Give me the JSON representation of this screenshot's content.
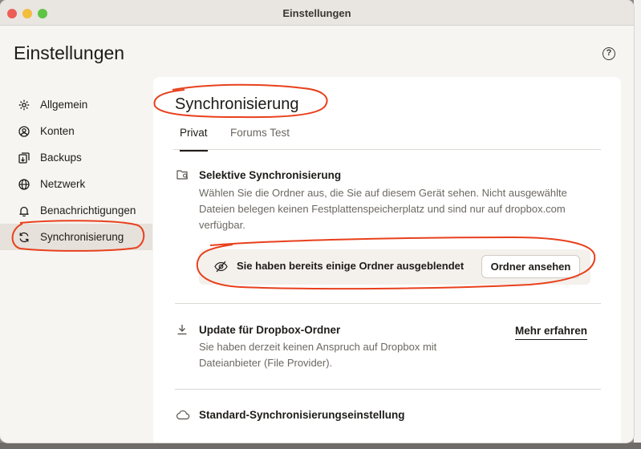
{
  "window": {
    "title": "Einstellungen"
  },
  "header": {
    "title": "Einstellungen",
    "help_icon": "question-circle-icon",
    "help_symbol": "?"
  },
  "sidebar": {
    "items": [
      {
        "label": "Allgemein",
        "icon": "gear-icon"
      },
      {
        "label": "Konten",
        "icon": "person-circle-icon"
      },
      {
        "label": "Backups",
        "icon": "backup-icon"
      },
      {
        "label": "Netzwerk",
        "icon": "globe-icon"
      },
      {
        "label": "Benachrichtigungen",
        "icon": "bell-icon"
      },
      {
        "label": "Synchronisierung",
        "icon": "sync-icon",
        "active": true
      }
    ]
  },
  "main": {
    "title": "Synchronisierung",
    "tabs": [
      {
        "label": "Privat",
        "active": true
      },
      {
        "label": "Forums Test",
        "active": false
      }
    ],
    "selective_sync": {
      "title": "Selektive Synchronisierung",
      "description_lines": [
        "Wählen Sie die Ordner aus, die Sie auf diesem Gerät sehen. Nicht ausgewählte",
        "Dateien belegen keinen Festplattenspeicherplatz und sind nur auf dropbox.com",
        "verfügbar."
      ],
      "banner_text": "Sie haben bereits einige Ordner ausgeblendet",
      "button_label": "Ordner ansehen",
      "icon": "folder-search-icon",
      "banner_icon": "eye-off-icon"
    },
    "update_folder": {
      "title": "Update für Dropbox-Ordner",
      "description_lines": [
        "Sie haben derzeit keinen Anspruch auf Dropbox mit",
        "Dateianbieter (File Provider)."
      ],
      "link_label": "Mehr erfahren",
      "icon": "download-icon"
    },
    "standard_sync": {
      "title": "Standard-Synchronisierungseinstellung",
      "icon": "cloud-icon"
    }
  },
  "colors": {
    "annotation": "#e8401c",
    "window_bg": "#f7f5f2",
    "panel_bg": "#ffffff",
    "active_item_bg": "#e6e1da"
  }
}
